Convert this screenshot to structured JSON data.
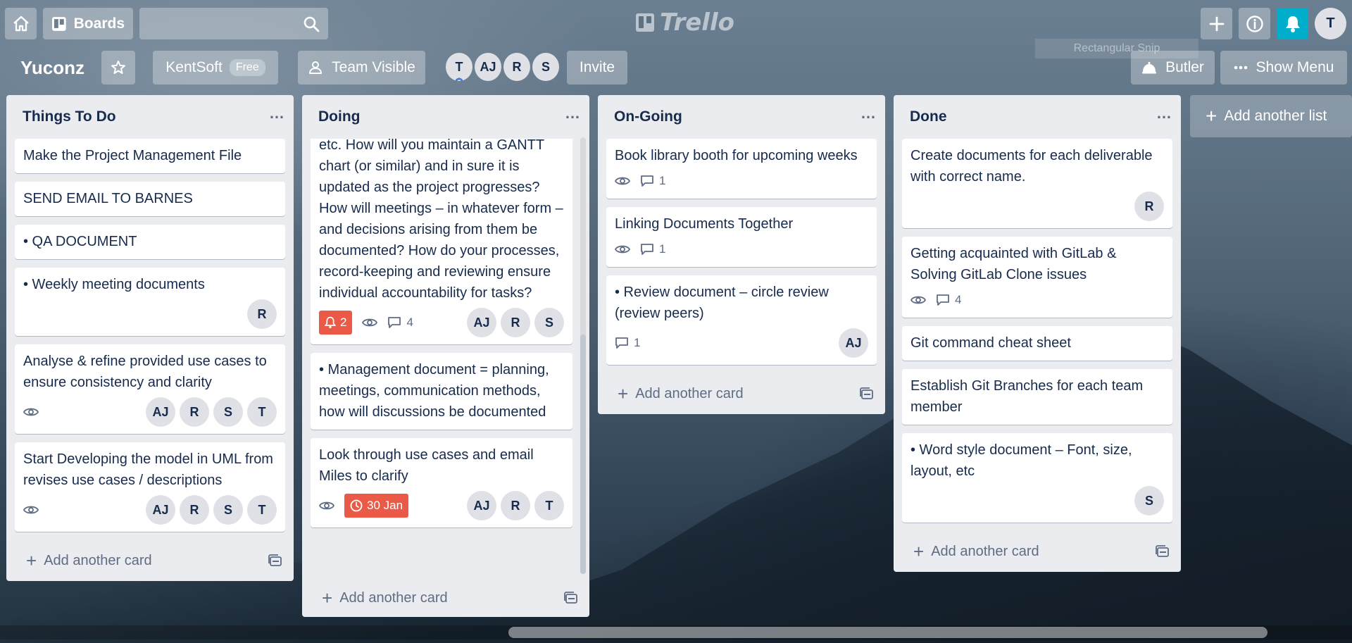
{
  "header": {
    "boards_label": "Boards",
    "search_placeholder": "",
    "logo_text": "Trello",
    "user_initial": "T",
    "snip_text": "Rectangular Snip"
  },
  "board": {
    "title": "Yuconz",
    "team_name": "KentSoft",
    "team_badge": "Free",
    "visibility_label": "Team Visible",
    "members": [
      "T",
      "AJ",
      "R",
      "S"
    ],
    "invite_label": "Invite",
    "butler_label": "Butler",
    "show_menu_label": "Show Menu"
  },
  "add_list_label": "Add another list",
  "add_card_label": "Add another card",
  "lists": [
    {
      "title": "Things To Do",
      "cards": [
        {
          "text": "Make the Project Management File"
        },
        {
          "text": "SEND EMAIL TO BARNES"
        },
        {
          "text": "• QA DOCUMENT"
        },
        {
          "text": "• Weekly meeting documents",
          "members": [
            "R"
          ]
        },
        {
          "text": "Analyse & refine provided use cases to ensure consistency and clarity",
          "watch": true,
          "members": [
            "AJ",
            "R",
            "S",
            "T"
          ]
        },
        {
          "text": "Start Developing the model in UML from revises use cases / descriptions",
          "watch": true,
          "members": [
            "AJ",
            "R",
            "S",
            "T"
          ]
        }
      ]
    },
    {
      "title": "Doing",
      "cards": [
        {
          "text": "etc. How will you maintain a GANTT chart (or similar) and in sure it is updated as the project progresses? How will meetings – in whatever form – and decisions arising from them be documented? How do your processes, record-keeping and reviewing ensure individual accountability for tasks?",
          "alert": "2",
          "watch": true,
          "comments": "4",
          "members": [
            "AJ",
            "R",
            "S"
          ]
        },
        {
          "text": "• Management document = planning, meetings, communication methods, how will discussions be documented"
        },
        {
          "text": "Look through use cases and email Miles to clarify",
          "watch": true,
          "due": "30 Jan",
          "members": [
            "AJ",
            "R",
            "T"
          ]
        }
      ]
    },
    {
      "title": "On-Going",
      "cards": [
        {
          "text": "Book library booth for upcoming weeks",
          "watch": true,
          "comments": "1"
        },
        {
          "text": "Linking Documents Together",
          "watch": true,
          "comments": "1"
        },
        {
          "text": "• Review document – circle review (review peers)",
          "comments": "1",
          "members": [
            "AJ"
          ]
        }
      ]
    },
    {
      "title": "Done",
      "cards": [
        {
          "text": "Create documents for each deliverable with correct name.",
          "members": [
            "R"
          ]
        },
        {
          "text": "Getting acquainted with GitLab & Solving GitLab Clone issues",
          "watch": true,
          "comments": "4"
        },
        {
          "text": "Git command cheat sheet"
        },
        {
          "text": "Establish Git Branches for each team member"
        },
        {
          "text": "• Word style document – Font, size, layout, etc",
          "members": [
            "S"
          ]
        }
      ]
    }
  ],
  "colors": {
    "notification": "#00aecc",
    "alert_red": "#eb5a46",
    "list_bg": "#ebecf0"
  }
}
